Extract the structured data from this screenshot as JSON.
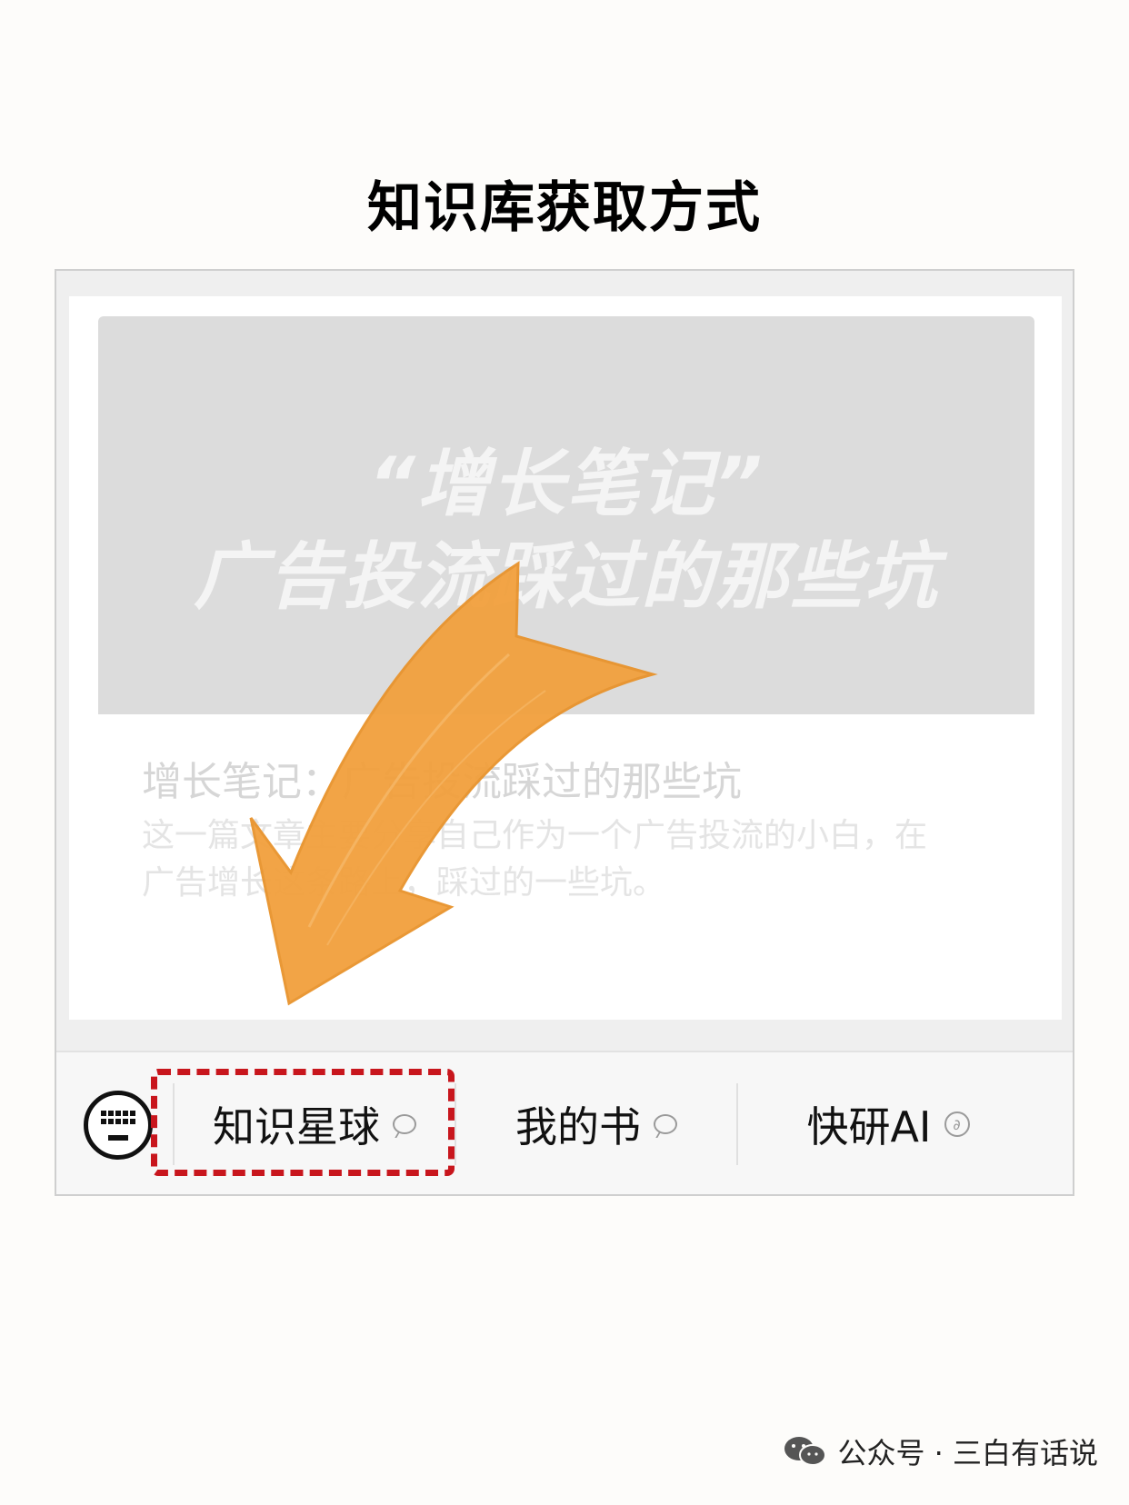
{
  "page": {
    "title": "知识库获取方式"
  },
  "article": {
    "cover_line_1": "“增长笔记”",
    "cover_line_2": "广告投流踩过的那些坑",
    "title": "增长笔记：广告投流踩过的那些坑",
    "summary": "这一篇文章主要分享自己作为一个广告投流的小白，在广告增长这条路上，踩过的一些坑。"
  },
  "menu": {
    "items": [
      {
        "label": "知识星球",
        "icon": "chat-bubble-icon"
      },
      {
        "label": "我的书",
        "icon": "chat-bubble-icon"
      },
      {
        "label": "快研AI",
        "icon": "link-icon"
      }
    ],
    "keyboard_icon": "keyboard-icon"
  },
  "footer": {
    "text": "公众号 · 三白有话说",
    "icon": "wechat-icon"
  },
  "colors": {
    "highlight": "#c8161d",
    "arrow": "#f2a03d",
    "cover": "#dcdcdc"
  }
}
